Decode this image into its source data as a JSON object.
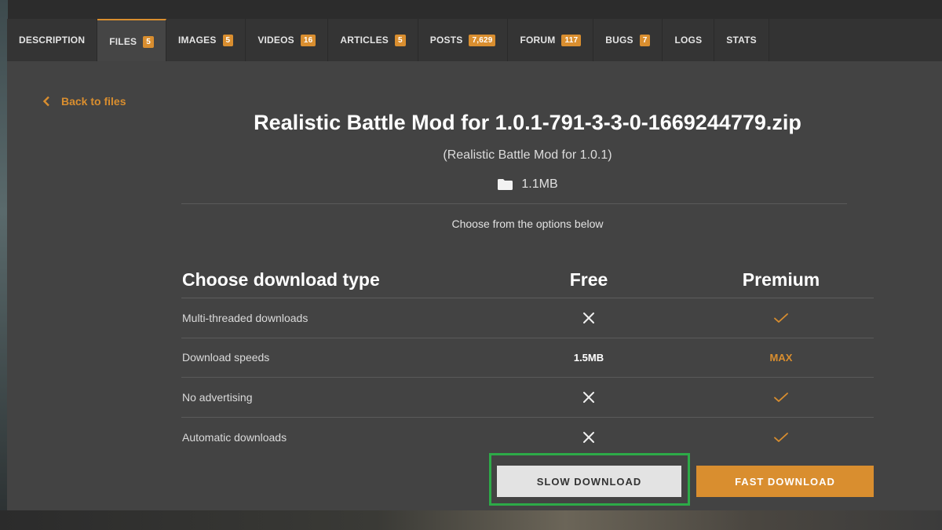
{
  "tabs": [
    {
      "label": "DESCRIPTION",
      "badge": null,
      "active": false
    },
    {
      "label": "FILES",
      "badge": "5",
      "active": true
    },
    {
      "label": "IMAGES",
      "badge": "5",
      "active": false
    },
    {
      "label": "VIDEOS",
      "badge": "16",
      "active": false
    },
    {
      "label": "ARTICLES",
      "badge": "5",
      "active": false
    },
    {
      "label": "POSTS",
      "badge": "7,629",
      "active": false
    },
    {
      "label": "FORUM",
      "badge": "117",
      "active": false
    },
    {
      "label": "BUGS",
      "badge": "7",
      "active": false
    },
    {
      "label": "LOGS",
      "badge": null,
      "active": false
    },
    {
      "label": "STATS",
      "badge": null,
      "active": false
    }
  ],
  "back_link": {
    "label": "Back to files",
    "icon": "chevron-left-icon"
  },
  "file": {
    "title": "Realistic Battle Mod for 1.0.1-791-3-3-0-1669244779.zip",
    "subtitle": "(Realistic Battle Mod for 1.0.1)",
    "size": "1.1MB",
    "size_icon": "folder-icon"
  },
  "choose_note": "Choose from the options below",
  "table": {
    "header": {
      "feature": "Choose download type",
      "free": "Free",
      "premium": "Premium"
    },
    "rows": [
      {
        "feature": "Multi-threaded downloads",
        "free": {
          "type": "cross"
        },
        "premium": {
          "type": "check"
        }
      },
      {
        "feature": "Download speeds",
        "free": {
          "type": "text",
          "text": "1.5MB"
        },
        "premium": {
          "type": "text",
          "text": "MAX"
        }
      },
      {
        "feature": "No advertising",
        "free": {
          "type": "cross"
        },
        "premium": {
          "type": "check"
        }
      },
      {
        "feature": "Automatic downloads",
        "free": {
          "type": "cross"
        },
        "premium": {
          "type": "check"
        }
      }
    ]
  },
  "buttons": {
    "slow": "SLOW DOWNLOAD",
    "fast": "FAST DOWNLOAD"
  },
  "colors": {
    "accent": "#d98e2f",
    "highlight": "#2daa48",
    "panel": "#434343",
    "tabbar": "#333333"
  }
}
